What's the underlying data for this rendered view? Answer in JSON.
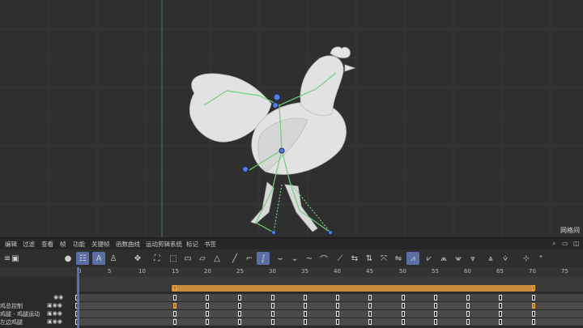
{
  "viewport": {
    "label": "网格间"
  },
  "menubar": {
    "items": [
      "编辑",
      "过滤",
      "查看",
      "帧",
      "功能",
      "关键帧",
      "函数曲线",
      "运动剪辑系统",
      "标记",
      "书签"
    ]
  },
  "timeline": {
    "ticks": [
      "0",
      "5",
      "10",
      "15",
      "20",
      "25",
      "30",
      "35",
      "40",
      "45",
      "50",
      "55",
      "60",
      "65",
      "70",
      "75"
    ],
    "current_frame": 0,
    "key_frames": [
      15,
      20,
      25,
      30,
      35,
      40,
      45,
      50,
      55,
      60,
      65,
      70
    ],
    "tracks": [
      {
        "label": ""
      },
      {
        "label": "鸡总控制"
      },
      {
        "label": "鸡腿 - 鸡腿运动"
      },
      {
        "label": "左边鸡腿"
      }
    ]
  },
  "colors": {
    "accent": "#5b6fa6",
    "selected_range": "#c98a3a",
    "rig": "#6fd17a"
  }
}
